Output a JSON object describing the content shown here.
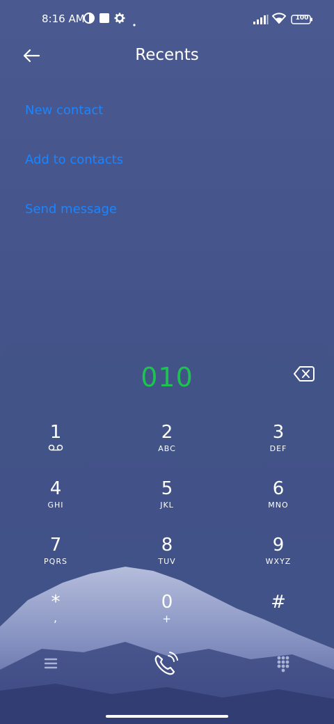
{
  "status_bar": {
    "time": "8:16 AM",
    "battery": "100",
    "icons": [
      "data-saver-icon",
      "square-notification-icon",
      "settings-gear-icon",
      "dot-icon",
      "signal-icon",
      "wifi-icon",
      "battery-icon"
    ]
  },
  "header": {
    "title": "Recents",
    "back_icon": "back-arrow-icon"
  },
  "menu": {
    "new_contact": "New contact",
    "add_to_contacts": "Add to contacts",
    "send_message": "Send message"
  },
  "dialer": {
    "number": "010",
    "backspace_icon": "backspace-icon",
    "keys": [
      {
        "digit": "1",
        "letters": "voicemail-icon"
      },
      {
        "digit": "2",
        "letters": "ABC"
      },
      {
        "digit": "3",
        "letters": "DEF"
      },
      {
        "digit": "4",
        "letters": "GHI"
      },
      {
        "digit": "5",
        "letters": "JKL"
      },
      {
        "digit": "6",
        "letters": "MNO"
      },
      {
        "digit": "7",
        "letters": "PQRS"
      },
      {
        "digit": "8",
        "letters": "TUV"
      },
      {
        "digit": "9",
        "letters": "WXYZ"
      },
      {
        "digit": "*",
        "letters": ","
      },
      {
        "digit": "0",
        "letters": "+"
      },
      {
        "digit": "#",
        "letters": ""
      }
    ]
  },
  "bottom_bar": {
    "menu_icon": "hamburger-menu-icon",
    "call_icon": "phone-call-icon",
    "keypad_icon": "keypad-icon"
  },
  "colors": {
    "accent_link": "#1a85ff",
    "number_green": "#1fc153",
    "background": "#4a5a91"
  }
}
